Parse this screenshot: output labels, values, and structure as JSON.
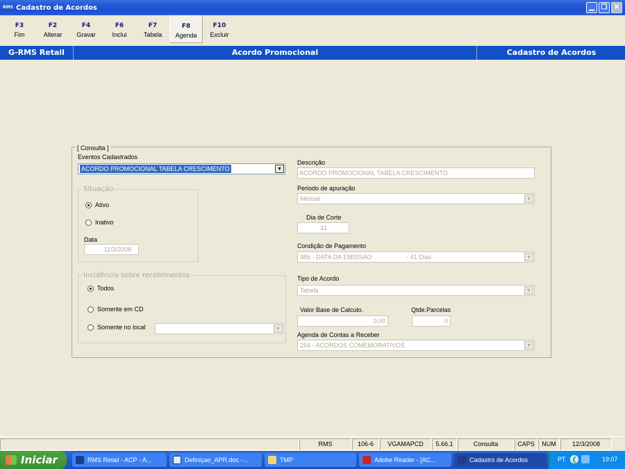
{
  "window": {
    "title": "Cadastro de Acordos",
    "app_badge": "RMS"
  },
  "fkeys": [
    {
      "key": "F3",
      "label": "Fim"
    },
    {
      "key": "F2",
      "label": "Alterar"
    },
    {
      "key": "F4",
      "label": "Gravar"
    },
    {
      "key": "F6",
      "label": "Inclui"
    },
    {
      "key": "F7",
      "label": "Tabela"
    },
    {
      "key": "F8",
      "label": "Agenda"
    },
    {
      "key": "F10",
      "label": "Excluir"
    }
  ],
  "header": {
    "left": "G-RMS Retail",
    "center": "Acordo Promocional",
    "right": "Cadastro de Acordos"
  },
  "form": {
    "consulta_label": "[ Consulta ]",
    "eventos_label": "Eventos Cadastrados",
    "eventos_value": "ACORDO PROMOCIONAL TABELA CRESCIMENTO",
    "situacao": {
      "caption": "Situação",
      "ativo": "Ativo",
      "inativo": "Inativo",
      "selected": "Ativo",
      "data_label": "Data",
      "data_value": "11/3/2008"
    },
    "incidencia": {
      "caption": "Incidência sobre recebimentos",
      "todos": "Todos",
      "cd": "Somente em CD",
      "local": "Somente no local",
      "selected": "Todos",
      "local_value": ""
    },
    "descricao_label": "Descrição",
    "descricao_value": "ACORDO PROMOCIONAL TABELA CRESCIMENTO",
    "periodo_label": "Periodo de apuração",
    "periodo_value": "Mensal",
    "dia_corte_label": "Dia de Corte",
    "dia_corte_value": "31",
    "condicao_label": "Condição de Pagamento",
    "condicao_value": "986 - DATA DA EMISSAO",
    "condicao_days": "- 41 Dias",
    "tipo_label": "Tipo de Acordo",
    "tipo_value": "Tabela",
    "valor_base_label": "Valor Base de Calculo.",
    "valor_base_value": "0,00",
    "qtde_parcelas_label": "Qtde.Parcelas",
    "qtde_parcelas_value": "0",
    "agenda_label": "Agenda de Contas a Receber",
    "agenda_value": "254 - ACORDOS COMEMORATIVOS"
  },
  "status": {
    "system": "RMS",
    "code": "106-6",
    "user": "VGAMAPCD",
    "version": "5.66.1",
    "mode": "Consulta",
    "caps": "CAPS",
    "num": "NUM",
    "date": "12/3/2008"
  },
  "taskbar": {
    "start": "Iniciar",
    "tasks": [
      "RMS Retail - ACP - A...",
      "Definiçao_APR.doc -...",
      "TMP",
      "Adobe Reader - [AC...",
      "Cadastro de Acordos"
    ],
    "lang": "PT",
    "clock": "19:07"
  }
}
